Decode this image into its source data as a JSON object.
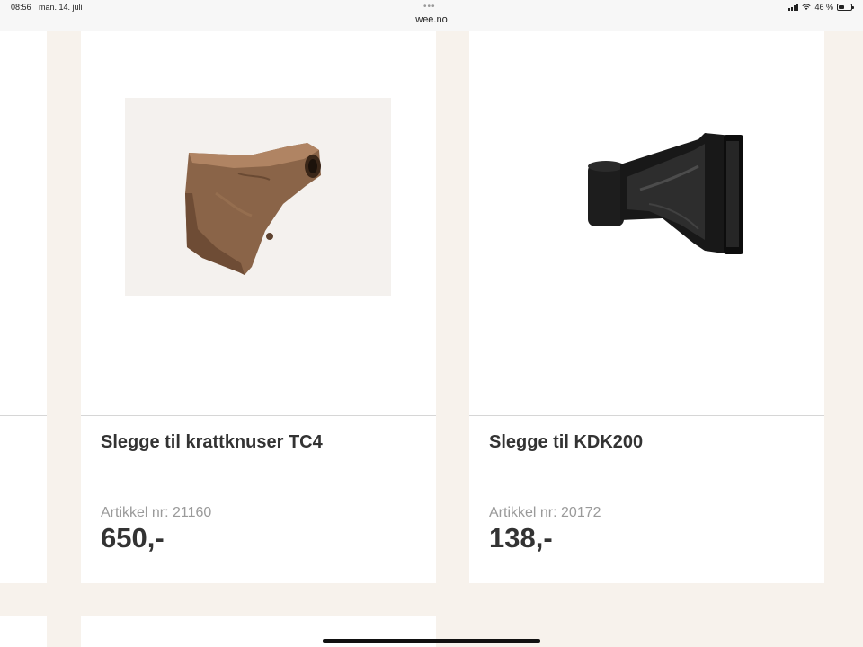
{
  "status_bar": {
    "time": "08:56",
    "date": "man. 14. juli",
    "url": "wee.no",
    "battery_text": "46 %",
    "battery_level": 0.46,
    "dots": "•••"
  },
  "products": [
    {
      "title": "Slegge til krattknuser TC4",
      "article": "Artikkel nr: 21160",
      "price": "650,-",
      "image_icon": "hammer-blade-rusty"
    },
    {
      "title": "Slegge til KDK200",
      "article": "Artikkel nr: 20172",
      "price": "138,-",
      "image_icon": "hammer-blade-black"
    }
  ],
  "colors": {
    "page_background": "#f7f2ec",
    "card_background": "#ffffff",
    "divider": "#d6d6d6",
    "title_text": "#333333",
    "article_text": "#9a9a9a"
  }
}
